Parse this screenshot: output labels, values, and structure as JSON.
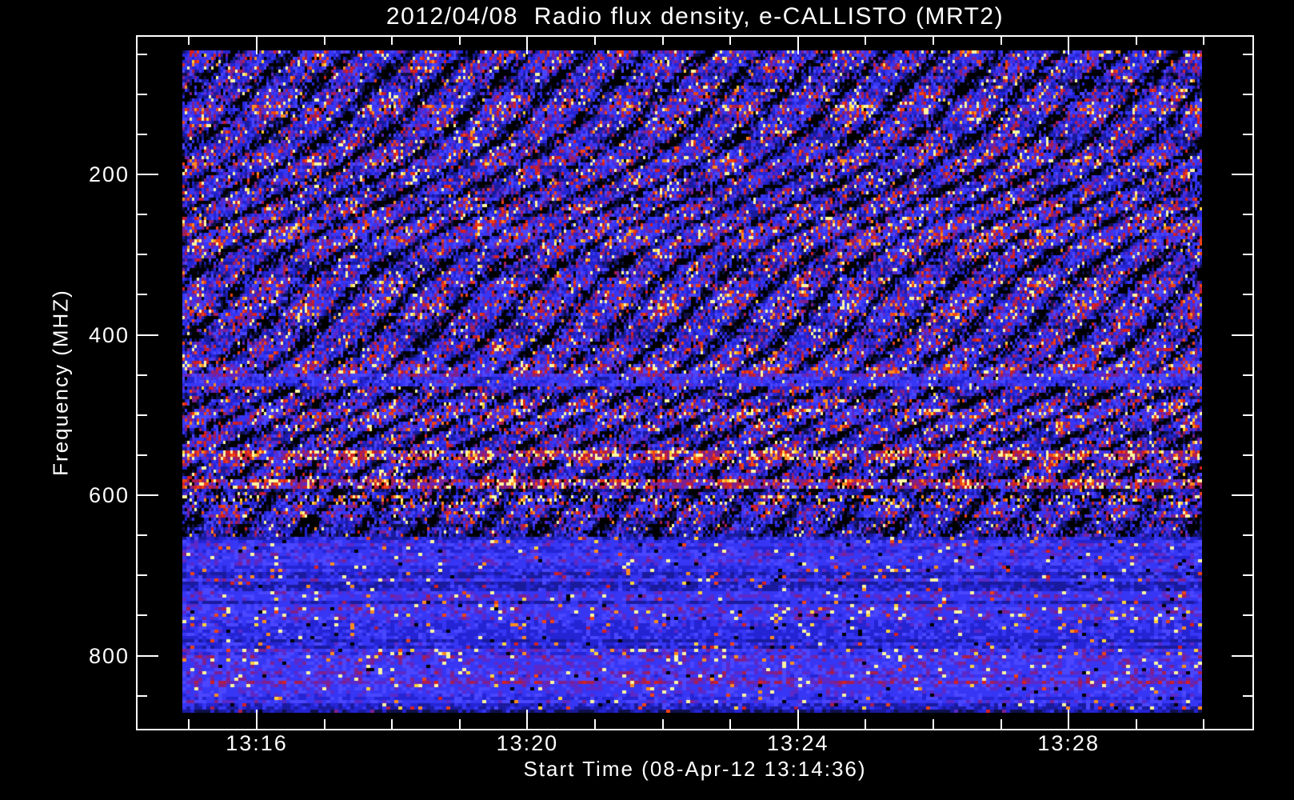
{
  "title": "2012/04/08  Radio flux density, e-CALLISTO (MRT2)",
  "axes": {
    "x": {
      "label": "Start Time (08-Apr-12 13:14:36)",
      "major_ticks": [
        {
          "label": "13:16",
          "minute": 16
        },
        {
          "label": "13:20",
          "minute": 20
        },
        {
          "label": "13:24",
          "minute": 24
        },
        {
          "label": "13:28",
          "minute": 28
        }
      ],
      "minor_tick_minutes": [
        15,
        17,
        18,
        19,
        21,
        22,
        23,
        25,
        26,
        27,
        29,
        30
      ]
    },
    "y": {
      "label": "Frequency (MHZ)",
      "major_ticks": [
        {
          "label": "200",
          "mhz": 200
        },
        {
          "label": "400",
          "mhz": 400
        },
        {
          "label": "600",
          "mhz": 600
        },
        {
          "label": "800",
          "mhz": 800
        }
      ],
      "minor_tick_mhz": [
        50,
        100,
        150,
        250,
        300,
        350,
        450,
        500,
        550,
        650,
        700,
        750,
        850
      ]
    }
  },
  "colors": {
    "background": "#000000",
    "frame": "#ffffff",
    "text": "#ffffff"
  },
  "chart_data": {
    "type": "heatmap",
    "title": "2012/04/08  Radio flux density, e-CALLISTO (MRT2)",
    "xlabel": "Start Time (08-Apr-12 13:14:36)",
    "ylabel": "Frequency (MHZ)",
    "date": "2012/04/08",
    "start_time": "13:14:36",
    "x_ticks": [
      "13:16",
      "13:20",
      "13:24",
      "13:28"
    ],
    "x_minor_step_minutes": 1,
    "x_range": [
      "13:14:40",
      "13:30:00"
    ],
    "y_ticks_mhz": [
      200,
      400,
      600,
      800
    ],
    "y_minor_step_mhz": 50,
    "y_range_mhz": [
      45,
      871
    ],
    "y_axis_orientation": "inverted (low frequency at top)",
    "colormap": "black-blue-purple-red-orange-yellow-white (low to high flux)",
    "features": [
      "dense noisy speckle of blue/red with dark wavy diagonal fringes from 45 to ~640 MHz",
      "narrow brighter blue band near 450-460 MHz",
      "bright orange RFI band near 550 MHz",
      "strong bright yellow RFI band near 580-590 MHz",
      "intermittent yellow-on-black RFI band near 600-612 MHz",
      "smooth blue background with sparse red speckles from ~650 to 871 MHz",
      "brighter blue band with red speckles near 800 MHz"
    ],
    "palette": [
      {
        "t": 0.1,
        "c": "#000000"
      },
      {
        "t": 0.2,
        "c": "#10104a"
      },
      {
        "t": 0.29,
        "c": "#1a1a9e"
      },
      {
        "t": 0.38,
        "c": "#2424d4"
      },
      {
        "t": 0.47,
        "c": "#3636f4"
      },
      {
        "t": 0.55,
        "c": "#4b46ff"
      },
      {
        "t": 0.62,
        "c": "#5c28c8"
      },
      {
        "t": 0.68,
        "c": "#7e2090"
      },
      {
        "t": 0.74,
        "c": "#a81e50"
      },
      {
        "t": 0.8,
        "c": "#d42020"
      },
      {
        "t": 0.87,
        "c": "#f04214"
      },
      {
        "t": 0.93,
        "c": "#ff8c1e"
      },
      {
        "t": 0.975,
        "c": "#ffd23c"
      },
      {
        "t": 9.0,
        "c": "#fff6a0"
      }
    ],
    "bands": [
      {
        "f0": 45,
        "f1": 448,
        "base": 0.3,
        "var": 0.52,
        "spike": 0.1,
        "wave": 0.42,
        "drop": 0.04
      },
      {
        "f0": 448,
        "f1": 462,
        "base": 0.42,
        "var": 0.22,
        "spike": 0.05,
        "wave": 0.1,
        "drop": 0.02
      },
      {
        "f0": 462,
        "f1": 545,
        "base": 0.3,
        "var": 0.54,
        "spike": 0.11,
        "wave": 0.45,
        "drop": 0.05
      },
      {
        "f0": 545,
        "f1": 557,
        "base": 0.55,
        "var": 0.38,
        "spike": 0.18,
        "wave": 0.3,
        "drop": 0.06
      },
      {
        "f0": 557,
        "f1": 578,
        "base": 0.27,
        "var": 0.5,
        "spike": 0.09,
        "wave": 0.45,
        "drop": 0.06
      },
      {
        "f0": 578,
        "f1": 592,
        "base": 0.68,
        "var": 0.3,
        "spike": 0.15,
        "wave": 0.15,
        "drop": 0.1
      },
      {
        "f0": 592,
        "f1": 600,
        "base": 0.2,
        "var": 0.42,
        "spike": 0.06,
        "wave": 0.3,
        "drop": 0.1
      },
      {
        "f0": 600,
        "f1": 613,
        "base": 0.3,
        "var": 0.3,
        "spike": 0.3,
        "wave": 0.2,
        "drop": 0.3
      },
      {
        "f0": 613,
        "f1": 650,
        "base": 0.28,
        "var": 0.48,
        "spike": 0.08,
        "wave": 0.35,
        "drop": 0.06
      },
      {
        "f0": 650,
        "f1": 740,
        "base": 0.33,
        "var": 0.26,
        "spike": 0.035,
        "wave": 0,
        "drop": 0.01
      },
      {
        "f0": 740,
        "f1": 768,
        "base": 0.38,
        "var": 0.26,
        "spike": 0.06,
        "wave": 0,
        "drop": 0.01
      },
      {
        "f0": 768,
        "f1": 790,
        "base": 0.33,
        "var": 0.24,
        "spike": 0.03,
        "wave": 0,
        "drop": 0.01
      },
      {
        "f0": 790,
        "f1": 806,
        "base": 0.4,
        "var": 0.26,
        "spike": 0.07,
        "wave": 0,
        "drop": 0.01
      },
      {
        "f0": 806,
        "f1": 832,
        "base": 0.34,
        "var": 0.26,
        "spike": 0.04,
        "wave": 0,
        "drop": 0.01
      },
      {
        "f0": 832,
        "f1": 871,
        "base": 0.37,
        "var": 0.24,
        "spike": 0.04,
        "wave": 0,
        "drop": 0.01
      }
    ]
  }
}
